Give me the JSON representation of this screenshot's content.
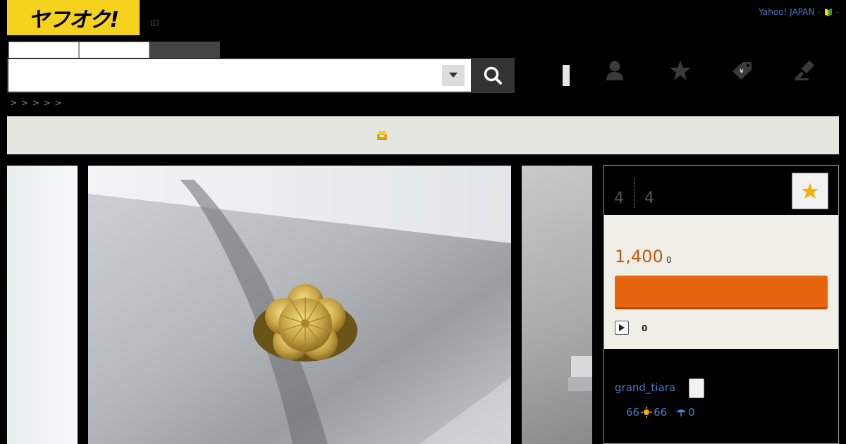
{
  "header": {
    "logo_text": "ヤフオク!",
    "id_label": "ID",
    "yahoo_link": "Yahoo! JAPAN",
    "separator": "-",
    "separator2": "-"
  },
  "search": {
    "query": "",
    "placeholder": ""
  },
  "breadcrumb": ">    > > > >",
  "listing": {
    "watch_count": "4",
    "bid_count": "4",
    "price": "1,400",
    "price_suffix": "0",
    "views": "0"
  },
  "seller": {
    "name": "grand_tiara",
    "good_total": "66",
    "good_count": "66",
    "bad_count": "0"
  },
  "colors": {
    "brand_yellow": "#f4d21d",
    "bid_orange": "#e8650f",
    "price_orange": "#c65a0b",
    "link_blue": "#4a7cc0"
  },
  "icons": [
    "search-icon",
    "chevron-down-icon",
    "user-icon",
    "star-icon",
    "tag-icon",
    "gavel-icon",
    "beginner-mark-icon",
    "play-icon",
    "sun-icon",
    "umbrella-icon"
  ]
}
